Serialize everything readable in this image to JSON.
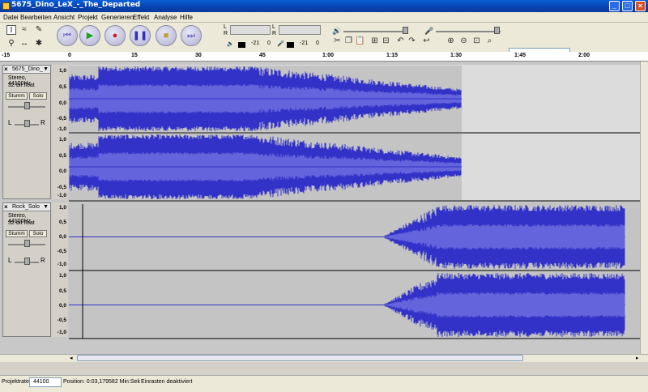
{
  "window": {
    "title": "5675_Dino_LeX_-_The_Departed",
    "min_label": "_",
    "max_label": "□",
    "close_label": "×"
  },
  "menu": [
    "Datei",
    "Bearbeiten",
    "Ansicht",
    "Projekt",
    "Generieren",
    "Effekt",
    "Analyse",
    "Hilfe"
  ],
  "tools": [
    "selection-tool",
    "envelope-tool",
    "draw-tool",
    "zoom-tool",
    "timeshift-tool",
    "multi-tool"
  ],
  "transport": [
    "skip-start",
    "play",
    "record",
    "pause",
    "stop",
    "skip-end"
  ],
  "meters": {
    "left": "L",
    "right": "R",
    "db1": "-21",
    "db2": "0",
    "db3": "-21",
    "db4": "0"
  },
  "ruler": {
    "ticks": [
      "-15",
      "0",
      "15",
      "30",
      "45",
      "1:00",
      "1:15",
      "1:30",
      "1:45",
      "2:00"
    ]
  },
  "tracks": [
    {
      "name": "5675_Dino_",
      "format": "Stereo, 44100Hz",
      "bits": "32-bit float",
      "mute": "Stumm",
      "solo": "Solo",
      "left": "L",
      "right": "R",
      "yticks": [
        "1,0",
        "0,5",
        "0,0",
        "-0,5",
        "-1,0"
      ]
    },
    {
      "name": "Rock_Solo",
      "format": "Stereo, 44100Hz",
      "bits": "32-bit float",
      "mute": "Stumm",
      "solo": "Solo",
      "left": "L",
      "right": "R",
      "yticks": [
        "1,0",
        "0,5",
        "0,0",
        "-0,5",
        "-1,0"
      ]
    }
  ],
  "status": {
    "rate_label": "Projektrate:",
    "rate": "44100",
    "position": "Position: 0:03,179582 Min:Sek",
    "snap": "Einrasten deaktiviert"
  },
  "colors": {
    "wave": "#3232c8",
    "wave_light": "#6464dc",
    "track_bg": "#c4c4c4",
    "selection": "#ffffff"
  }
}
